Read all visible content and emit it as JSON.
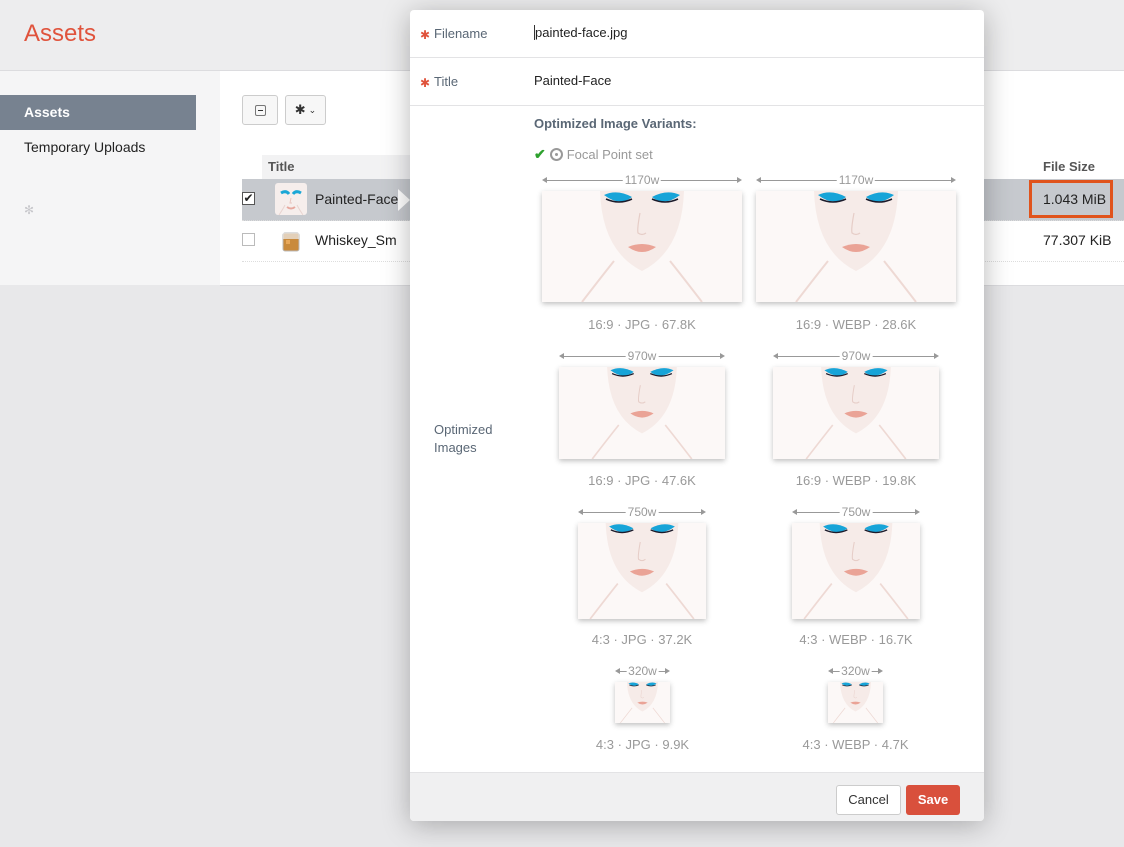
{
  "app": {
    "title": "Assets"
  },
  "sidebar": {
    "items": [
      {
        "label": "Assets"
      },
      {
        "label": "Temporary Uploads"
      }
    ]
  },
  "table": {
    "columns": {
      "title": "Title",
      "file_size": "File Size"
    },
    "rows": [
      {
        "title": "Painted-Face",
        "file_size": "1.043 MiB",
        "checked": true
      },
      {
        "title": "Whiskey_Sm",
        "file_size": "77.307 KiB",
        "checked": false
      }
    ]
  },
  "modal": {
    "filename_label": "Filename",
    "filename_value": "painted-face.jpg",
    "title_label": "Title",
    "title_value": "Painted-Face",
    "optimized_label": "Optimized Images",
    "variants_heading": "Optimized Image Variants:",
    "focal_point": "Focal Point set",
    "variants": [
      {
        "width": "1170w",
        "caption": "16:9 · JPG · 67.8K"
      },
      {
        "width": "1170w",
        "caption": "16:9 · WEBP · 28.6K"
      },
      {
        "width": "970w",
        "caption": "16:9 · JPG · 47.6K"
      },
      {
        "width": "970w",
        "caption": "16:9 · WEBP · 19.8K"
      },
      {
        "width": "750w",
        "caption": "4:3 · JPG · 37.2K"
      },
      {
        "width": "750w",
        "caption": "4:3 · WEBP · 16.7K"
      },
      {
        "width": "320w",
        "caption": "4:3 · JPG · 9.9K"
      },
      {
        "width": "320w",
        "caption": "4:3 · WEBP · 4.7K"
      }
    ],
    "cancel_label": "Cancel",
    "save_label": "Save"
  },
  "icons": {
    "gear": "gear-icon",
    "minus": "minus-icon",
    "focal_check": "check-icon",
    "focal_aperture": "aperture-icon"
  },
  "colors": {
    "accent": "#e0533c",
    "sidebar_active": "#778290",
    "save_button": "#d9503c",
    "highlight": "#e0531c"
  }
}
